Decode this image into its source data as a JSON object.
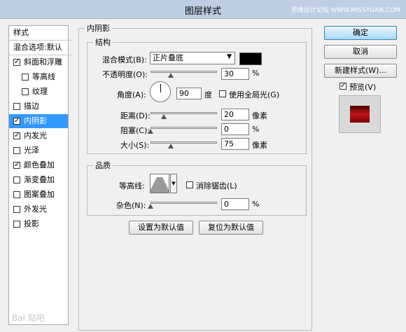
{
  "window": {
    "title": "图层样式",
    "watermark": "思缘设计论坛 WWW.MISSYUAN.COM"
  },
  "left_panel": {
    "header": "样式",
    "blend_options": "混合选项:默认",
    "items": [
      {
        "label": "斜面和浮雕",
        "checked": true
      },
      {
        "label": "等高线",
        "checked": false
      },
      {
        "label": "纹理",
        "checked": false
      },
      {
        "label": "描边",
        "checked": false
      },
      {
        "label": "内阴影",
        "checked": true
      },
      {
        "label": "内发光",
        "checked": true
      },
      {
        "label": "光泽",
        "checked": false
      },
      {
        "label": "颜色叠加",
        "checked": true
      },
      {
        "label": "渐变叠加",
        "checked": false
      },
      {
        "label": "图案叠加",
        "checked": false
      },
      {
        "label": "外发光",
        "checked": false
      },
      {
        "label": "投影",
        "checked": false
      }
    ],
    "selected_index": 4,
    "baidu_watermark": "Bai 贴吧"
  },
  "inner_shadow": {
    "group_title": "内阴影",
    "structure_title": "结构",
    "blend_mode_label": "混合模式(B):",
    "blend_mode_value": "正片叠底",
    "blend_color": "#000000",
    "opacity_label": "不透明度(O):",
    "opacity_value": "30",
    "opacity_fraction": 0.3,
    "percent": "%",
    "angle_label": "角度(A):",
    "angle_value": "90",
    "degree_unit": "度",
    "global_light_label": "使用全局光(G)",
    "global_light_checked": false,
    "distance_label": "距离(D):",
    "distance_value": "20",
    "distance_fraction": 0.2,
    "pixel_unit": "像素",
    "choke_label": "阻塞(C):",
    "choke_value": "0",
    "choke_fraction": 0.0,
    "size_label": "大小(S):",
    "size_value": "75",
    "size_fraction": 0.3
  },
  "quality": {
    "group_title": "品质",
    "contour_label": "等高线:",
    "antialias_label": "消除锯齿(L)",
    "antialias_checked": false,
    "noise_label": "杂色(N):",
    "noise_value": "0",
    "noise_fraction": 0.0,
    "percent": "%"
  },
  "defaults": {
    "set_default": "设置为默认值",
    "reset_default": "复位为默认值"
  },
  "right_panel": {
    "ok": "确定",
    "cancel": "取消",
    "new_style": "新建样式(W)...",
    "preview_label": "预览(V)",
    "preview_checked": true,
    "preview_color": "#a01010"
  }
}
